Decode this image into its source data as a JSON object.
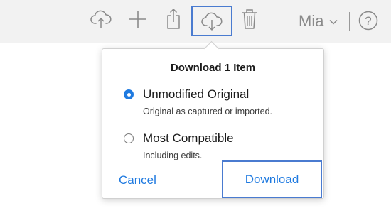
{
  "toolbar": {
    "user_name": "Mia",
    "icons": [
      "cloud-upload-icon",
      "plus-icon",
      "share-icon",
      "cloud-download-icon",
      "trash-icon",
      "chevron-down-icon",
      "help-icon"
    ],
    "help_glyph": "?"
  },
  "popover": {
    "title": "Download 1 Item",
    "options": [
      {
        "label": "Unmodified Original",
        "description": "Original as captured or imported.",
        "selected": true
      },
      {
        "label": "Most Compatible",
        "description": "Including edits.",
        "selected": false
      }
    ],
    "cancel_label": "Cancel",
    "download_label": "Download"
  },
  "colors": {
    "accent": "#1f7ae0",
    "highlight_border": "#4a7bd0",
    "toolbar_bg": "#f2f2f2",
    "icon_gray": "#8a8a8a"
  }
}
